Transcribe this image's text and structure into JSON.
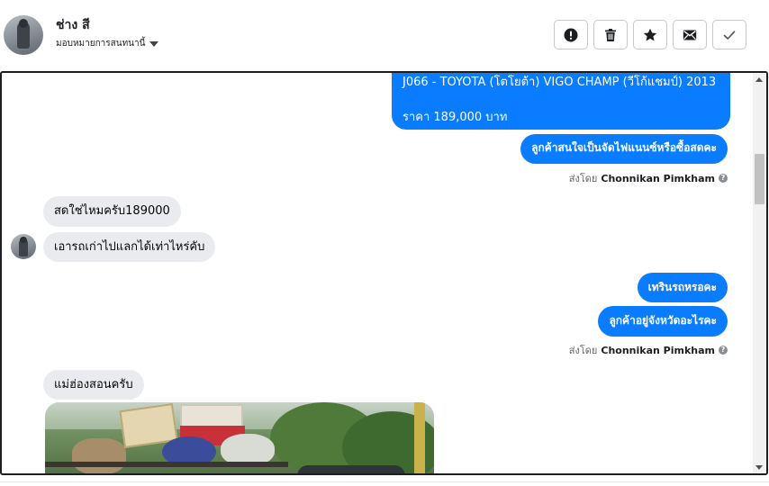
{
  "header": {
    "contact_name": "ช่าง สี",
    "assign_label": "มอบหมายการสนทนานี้",
    "actions": [
      {
        "name": "mark-spam",
        "icon": "exclamation-circle-icon"
      },
      {
        "name": "delete",
        "icon": "trash-icon"
      },
      {
        "name": "star",
        "icon": "star-icon"
      },
      {
        "name": "mark-unread",
        "icon": "envelope-icon"
      },
      {
        "name": "mark-done",
        "icon": "check-icon"
      }
    ]
  },
  "messages": {
    "car_card": {
      "title": "J066 - TOYOTA (โตโยต้า) VIGO CHAMP (วีโก้แชมป์) 2013",
      "price": "ราคา 189,000 บาท"
    },
    "out_1": "ลูกค้าสนใจเป็นจัดไฟแนนซ์หรือซื้อสดคะ",
    "sent_by_1": {
      "prefix": "ส่งโดย",
      "agent": "Chonnikan Pimkham"
    },
    "in_1": "สดใช่ไหมครับ189000",
    "in_2": "เอารถเก่าไปแลกได้เท่าไหร่คับ",
    "out_2": "เทรินรถหรอคะ",
    "out_3": "ลูกค้าอยู่จังหวัดอะไรคะ",
    "sent_by_2": {
      "prefix": "ส่งโดย",
      "agent": "Chonnikan Pimkham"
    },
    "in_3": "แม่ฮ่องสอนครับ"
  },
  "colors": {
    "outgoing_bubble": "#0a7cff",
    "incoming_bubble": "#eaebee",
    "muted_text": "#65676b"
  }
}
